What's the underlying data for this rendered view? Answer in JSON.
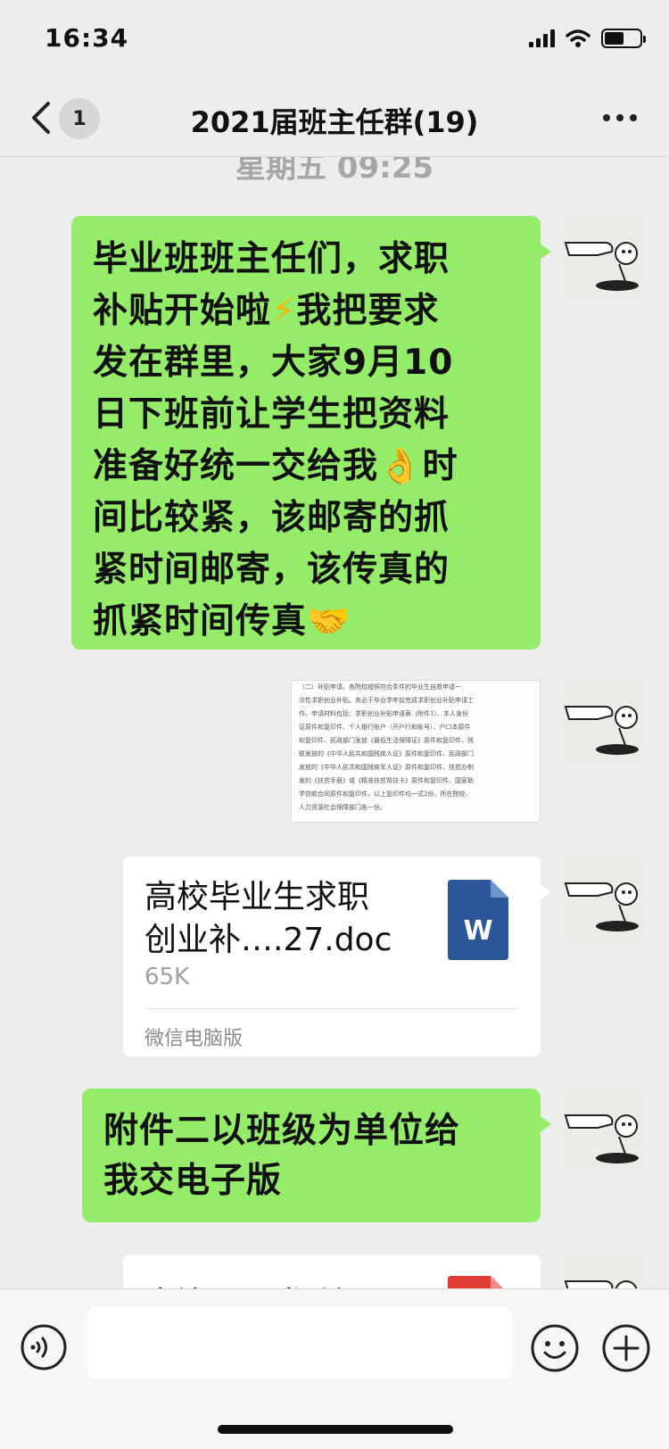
{
  "status_bar": {
    "time": "16:34"
  },
  "header": {
    "unread_count": "1",
    "title": "2021届班主任群(19)"
  },
  "timestamp": "星期五 09:25",
  "messages": {
    "m1": {
      "line1": "毕业班班主任们，求职",
      "line2_a": "补贴开始啦",
      "line2_emoji": "⚡",
      "line2_b": "我把要求",
      "line3": "发在群里，大家9月10",
      "line4": "日下班前让学生把资料",
      "line5_a": "准备好统一交给我",
      "line5_emoji": "👌",
      "line5_b": "时",
      "line6": "间比较紧，该邮寄的抓",
      "line7": "紧时间邮寄，该传真的",
      "line8_a": "抓紧时间传真",
      "line8_emoji": "🤝"
    },
    "m2_image": {
      "doc_lines": [
        "（二）补贴申请。各院校按照符合条件的毕业生自愿申请一",
        "次性求职创业补贴。务必于毕业学年前完成求职创业补贴申请工",
        "作。申请材料包括：求职创业补贴申请表（附件1）、本人身份",
        "证原件和复印件、个人银行账户（开户行和账号）、户口本原件",
        "和复印件、民政部门发放《最低生活保障证》原件和复印件、残",
        "联发放的《中华人民共和国残疾人证》原件和复印件、民政部门",
        "发放的《中华人民共和国残疾军人证》原件和复印件、扶贫办制",
        "发的《扶贫手册》或《精准扶贫帮扶卡》原件和复印件、国家助",
        "学贷款合同原件和复印件，以上复印件均一式2份，所在院校、",
        "人力资源社会保障部门各一份。"
      ]
    },
    "m3_file": {
      "name_line1": "高校毕业生求职",
      "name_line2": "创业补….27.doc",
      "size": "65K",
      "source": "微信电脑版",
      "icon_letter": "W"
    },
    "m4": {
      "line1": "附件二以班级为单位给",
      "line2": "我交电子版"
    },
    "m5_file": {
      "name_partial": "自治区下发 关于"
    }
  },
  "input_bar": {
    "value": ""
  },
  "colors": {
    "bubble_green": "#95ec69",
    "background": "#ededed",
    "word_blue": "#2b579a",
    "pdf_red": "#e03c31"
  },
  "icons": [
    "signal-icon",
    "wifi-icon",
    "battery-icon",
    "back-chevron-icon",
    "more-dots-icon",
    "word-file-icon",
    "pdf-file-icon",
    "voice-icon",
    "emoji-icon",
    "plus-icon"
  ]
}
